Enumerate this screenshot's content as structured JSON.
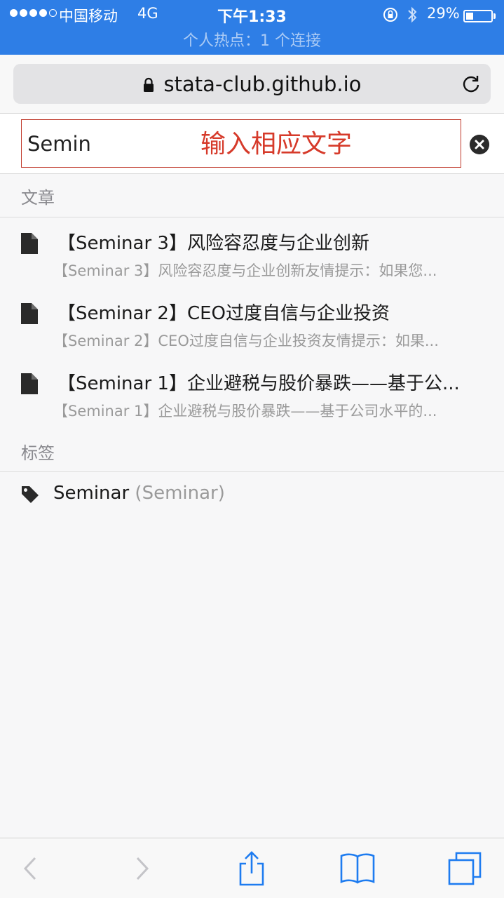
{
  "status_bar": {
    "carrier": "中国移动",
    "network": "4G",
    "time": "下午1:33",
    "battery_percent": "29%",
    "battery_level": 0.29,
    "hotspot_text": "个人热点：1 个连接",
    "icons": [
      "signal-dots",
      "rotation-lock-icon",
      "bluetooth-icon",
      "battery-icon"
    ]
  },
  "browser": {
    "url": "stata-club.github.io",
    "icons": [
      "padlock-icon",
      "reload-icon"
    ]
  },
  "search": {
    "value": "Semin",
    "annotation": "输入相应文字"
  },
  "sections": {
    "articles_header": "文章",
    "tags_header": "标签"
  },
  "results": [
    {
      "title": "【Seminar 3】风险容忍度与企业创新",
      "snippet": "【Seminar 3】风险容忍度与企业创新友情提示：如果您..."
    },
    {
      "title": "【Seminar 2】CEO过度自信与企业投资",
      "snippet": "【Seminar 2】CEO过度自信与企业投资友情提示：如果..."
    },
    {
      "title": "【Seminar 1】企业避税与股价暴跌——基于公...",
      "snippet": "【Seminar 1】企业避税与股价暴跌——基于公司水平的..."
    }
  ],
  "tag": {
    "name": "Seminar",
    "detail": "(Seminar)"
  },
  "toolbar": {
    "icons": [
      "back-icon",
      "forward-icon",
      "share-icon",
      "bookmarks-icon",
      "tabs-icon"
    ]
  },
  "colors": {
    "status_bar": "#2e7ee6",
    "toolbar_accent": "#1e7cf0",
    "annotation": "#d63a2a"
  }
}
